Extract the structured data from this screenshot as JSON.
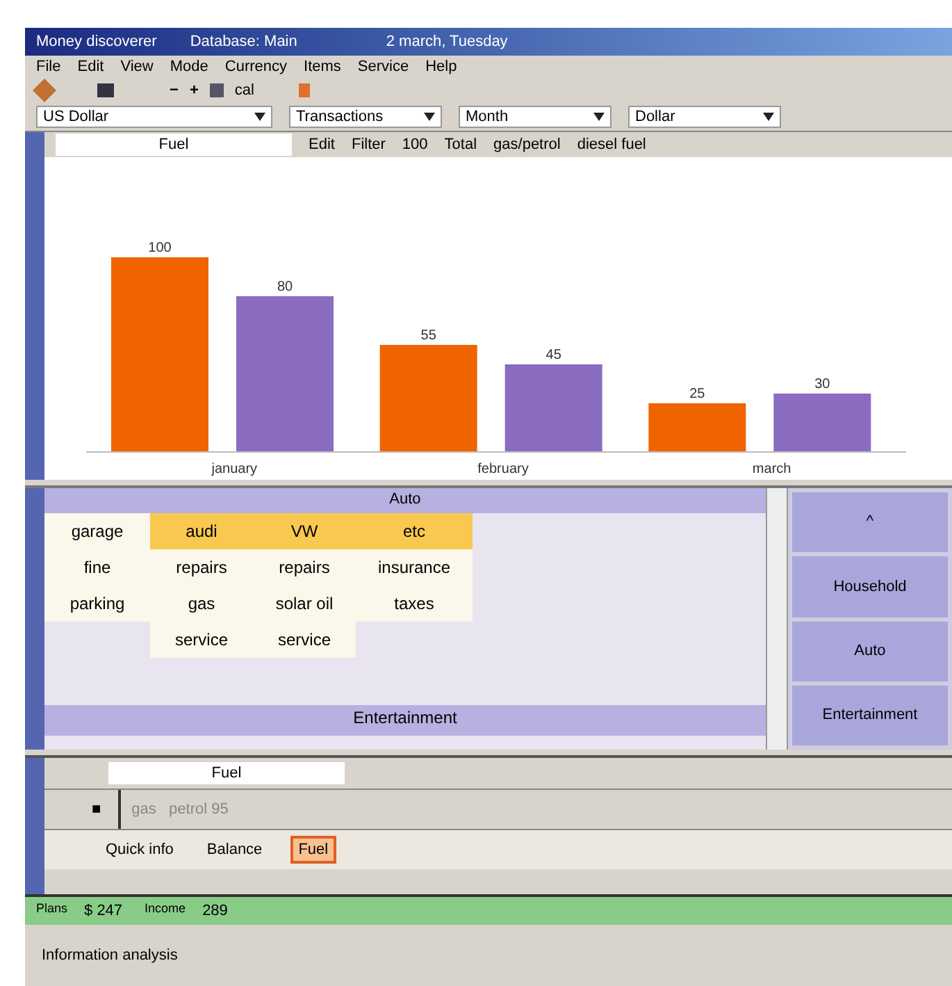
{
  "window": {
    "title": "Money discoverer",
    "database": "Database: Main",
    "date": "2 march, Tuesday"
  },
  "menu": [
    "File",
    "Edit",
    "View",
    "Mode",
    "Currency",
    "Items",
    "Service",
    "Help"
  ],
  "toolbar_symbols": [
    "−",
    "+"
  ],
  "toolbar_text": "cal",
  "dropdowns": [
    "US Dollar",
    "Transactions",
    "Month",
    "Dollar"
  ],
  "chart_toolbar": {
    "field": "Fuel",
    "items": [
      "Edit",
      "Filter",
      "100",
      "Total",
      "gas/petrol",
      "diesel fuel"
    ]
  },
  "chart": {
    "chart_data": {
      "type": "bar",
      "categories": [
        "january",
        "february",
        "march"
      ],
      "series": [
        {
          "color": "#f06400",
          "values": [
            100,
            55,
            25
          ]
        },
        {
          "color": "#8a6cc0",
          "values": [
            80,
            45,
            30
          ]
        }
      ],
      "data_labels": true
    }
  },
  "categories": {
    "header": "Auto",
    "rows": [
      {
        "cells": [
          "garage",
          "audi",
          "VW",
          "etc"
        ],
        "highlight": true
      },
      {
        "cells": [
          "fine",
          "repairs",
          "repairs",
          "insurance"
        ],
        "highlight": false
      },
      {
        "cells": [
          "parking",
          "gas",
          "solar oil",
          "taxes"
        ],
        "highlight": false
      },
      {
        "cells": [
          "",
          "service",
          "service",
          ""
        ],
        "highlight": false
      }
    ],
    "footer": "Entertainment"
  },
  "side_buttons": [
    "^",
    "Household",
    "Auto",
    "Entertainment"
  ],
  "fuel": {
    "header": "Fuel",
    "marker": "■",
    "placeholder": "gas   petrol 95"
  },
  "tabs": [
    {
      "label": "Quick info",
      "selected": false
    },
    {
      "label": "Balance",
      "selected": false
    },
    {
      "label": "Fuel",
      "selected": true
    }
  ],
  "totals": [
    {
      "label": "Plans",
      "value": "$ 247"
    },
    {
      "label": "Income",
      "value": "289"
    }
  ],
  "status_bar": "Information analysis"
}
